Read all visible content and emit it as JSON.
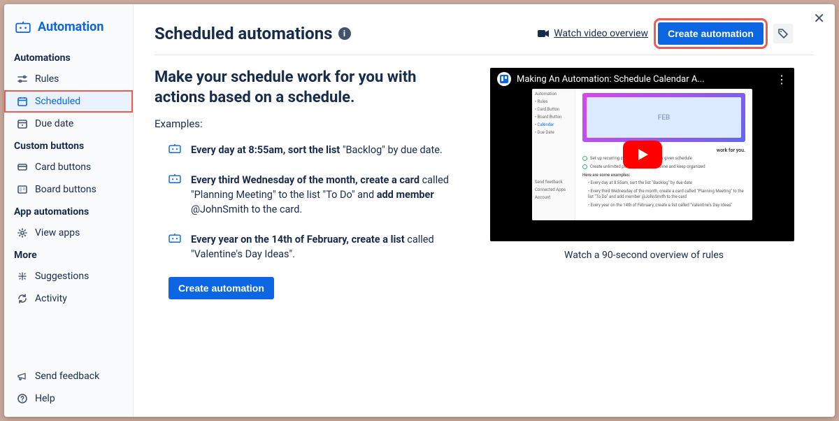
{
  "header": {
    "brand": "Automation"
  },
  "sidebar": {
    "sections": [
      {
        "title": "Automations",
        "items": [
          {
            "label": "Rules"
          },
          {
            "label": "Scheduled",
            "selected": true
          },
          {
            "label": "Due date"
          }
        ]
      },
      {
        "title": "Custom buttons",
        "items": [
          {
            "label": "Card buttons"
          },
          {
            "label": "Board buttons"
          }
        ]
      },
      {
        "title": "App automations",
        "items": [
          {
            "label": "View apps"
          }
        ]
      },
      {
        "title": "More",
        "items": [
          {
            "label": "Suggestions"
          },
          {
            "label": "Activity"
          }
        ]
      }
    ],
    "footer": [
      {
        "label": "Send feedback"
      },
      {
        "label": "Help"
      }
    ]
  },
  "page": {
    "title": "Scheduled automations",
    "watch_link": "Watch video overview",
    "create_btn": "Create automation",
    "hero": "Make your schedule work for you with actions based on a schedule.",
    "examples_label": "Examples:",
    "examples": [
      {
        "bold1": "Every day at 8:55am, sort the list",
        "mid": " \"Backlog\" by due date."
      },
      {
        "bold1": "Every third Wednesday of the month, create a card",
        "mid": " called \"Planning Meeting\" to the list \"To Do\" and ",
        "bold2": "add member",
        "tail": " @JohnSmith to the card."
      },
      {
        "bold1": "Every year on the 14th of February, create a list",
        "mid": " called \"Valentine's Day Ideas\"."
      }
    ],
    "create_btn2": "Create automation",
    "video_title": "Making An Automation: Schedule Calendar A...",
    "video_banner": "FEB",
    "video_subtext": "work for you.",
    "video_caption": "Watch a 90-second overview of rules"
  }
}
